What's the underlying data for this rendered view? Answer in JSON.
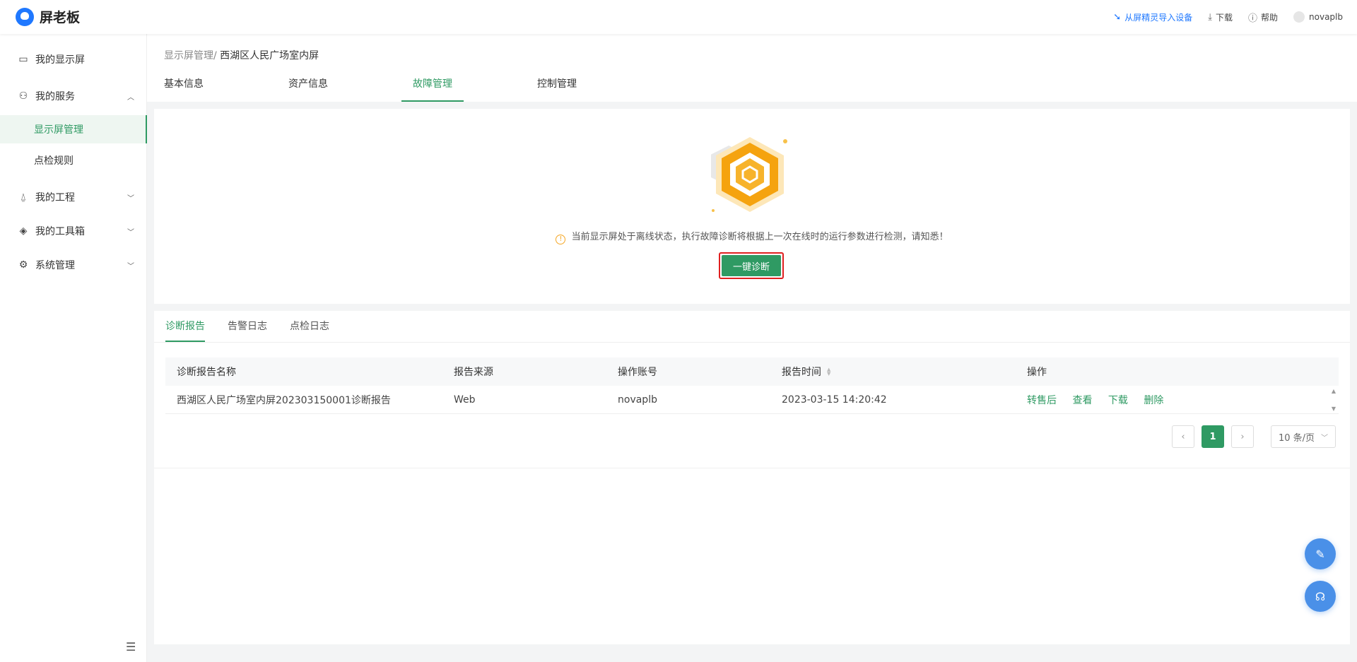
{
  "app": {
    "name": "屏老板"
  },
  "topbar": {
    "import_label": "从屏精灵导入设备",
    "download_label": "下载",
    "help_label": "帮助",
    "username": "novaplb"
  },
  "sidebar": {
    "items": [
      {
        "label": "我的显示屏",
        "icon": "monitor-icon"
      },
      {
        "label": "我的服务",
        "icon": "user-icon",
        "expanded": true
      },
      {
        "label": "我的工程",
        "icon": "project-icon"
      },
      {
        "label": "我的工具箱",
        "icon": "layers-icon"
      },
      {
        "label": "系统管理",
        "icon": "gear-icon"
      }
    ],
    "sub_items": [
      {
        "label": "显示屏管理",
        "active": true
      },
      {
        "label": "点检规则"
      }
    ]
  },
  "breadcrumb": {
    "parent": "显示屏管理/",
    "current": "西湖区人民广场室内屏"
  },
  "tabs": [
    "基本信息",
    "资产信息",
    "故障管理",
    "控制管理"
  ],
  "active_tab": "故障管理",
  "diagnosis": {
    "notice": "当前显示屏处于离线状态，执行故障诊断将根据上一次在线时的运行参数进行检测，请知悉！",
    "button_label": "一键诊断"
  },
  "report_tabs": [
    "诊断报告",
    "告警日志",
    "点检日志"
  ],
  "active_report_tab": "诊断报告",
  "table": {
    "columns": [
      "诊断报告名称",
      "报告来源",
      "操作账号",
      "报告时间",
      "操作"
    ],
    "rows": [
      {
        "name": "西湖区人民广场室内屏202303150001诊断报告",
        "source": "Web",
        "account": "novaplb",
        "time": "2023-03-15 14:20:42",
        "actions": [
          "转售后",
          "查看",
          "下载",
          "删除"
        ]
      }
    ]
  },
  "pagination": {
    "current_page": "1",
    "page_size": "10 条/页"
  },
  "colors": {
    "primary": "#2f9a63",
    "link": "#1f78ff",
    "float": "#4a90e8",
    "highlight": "#e02020"
  }
}
